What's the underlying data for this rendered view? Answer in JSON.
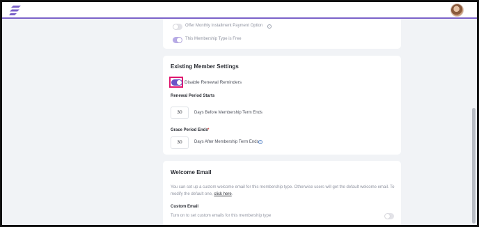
{
  "colors": {
    "accent": "#7b62c9",
    "toggle_on": "#6a53c8",
    "highlight": "#e0186f",
    "required": "#d23c3c",
    "info_blue": "#5a87c8"
  },
  "header": {
    "logo_icon": "brand-logo-icon",
    "avatar_icon": "user-avatar"
  },
  "membership_options": {
    "installment_label": "Offer Monthly Installment Payment Option",
    "installment_on": false,
    "free_label": "This Membership Type is Free",
    "free_on": true
  },
  "existing_member": {
    "title": "Existing Member Settings",
    "disable_reminders_label": "Disable Renewal Reminders",
    "disable_reminders_on": true,
    "renewal_label": "Renewal Period Starts",
    "renewal_value": "30",
    "renewal_hint": "Days Before Membership Term Ends",
    "grace_label": "Grace Period Ends",
    "grace_required_mark": "*",
    "grace_value": "30",
    "grace_hint": "Days After Membership Term Ends"
  },
  "welcome_email": {
    "title": "Welcome Email",
    "description_1": "You can set up a custom welcome email for this membership type. Otherwise users will get the default welcome email. To",
    "description_2_prefix": "modify the default one, ",
    "link_text": "click here",
    "description_2_suffix": ".",
    "custom_email_label": "Custom Email",
    "custom_email_desc": "Turn on to set custom emails for this membership type",
    "custom_email_on": false
  }
}
